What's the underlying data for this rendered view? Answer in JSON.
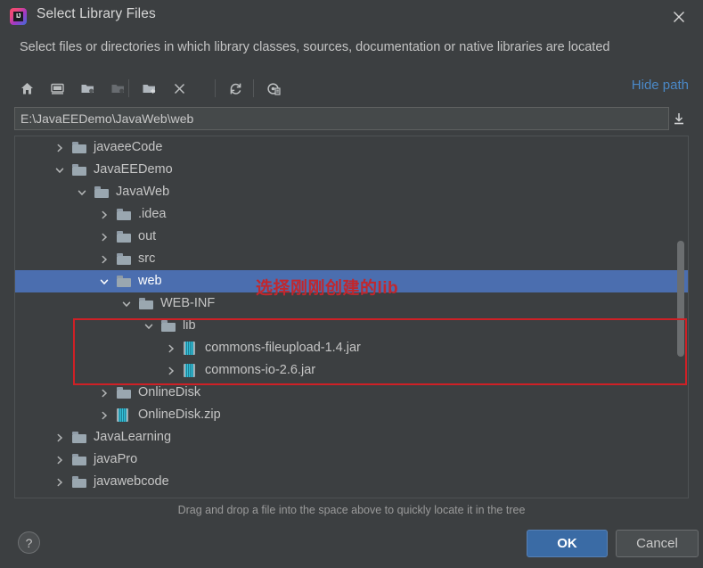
{
  "window": {
    "title": "Select Library Files",
    "app_icon": "intellij-idea-icon",
    "app_icon_text": "IJ",
    "close_icon": "close-icon",
    "description": "Select files or directories in which library classes, sources, documentation or native libraries are located"
  },
  "toolbar": {
    "buttons": [
      {
        "name": "home-icon",
        "tooltip": "Home",
        "disabled": false
      },
      {
        "name": "desktop-icon",
        "tooltip": "Desktop",
        "disabled": false
      },
      {
        "name": "project-folder-icon",
        "tooltip": "Project Directory",
        "disabled": false
      },
      {
        "name": "module-folder-icon",
        "tooltip": "Module Directory",
        "disabled": true
      },
      {
        "name": "new-folder-icon",
        "tooltip": "New Folder",
        "disabled": false
      },
      {
        "name": "delete-icon",
        "tooltip": "Delete",
        "disabled": false
      },
      {
        "name": "refresh-icon",
        "tooltip": "Refresh",
        "disabled": false
      },
      {
        "name": "show-hidden-files-icon",
        "tooltip": "Show Hidden Files",
        "disabled": false
      }
    ],
    "hide_path_label": "Hide path"
  },
  "path": {
    "value": "E:\\JavaEEDemo\\JavaWeb\\web",
    "placeholder": "",
    "expand_icon": "expand-path-icon"
  },
  "tree": {
    "rows": [
      {
        "label": "javaeeCode",
        "depth": 1,
        "icon": "folder-icon",
        "arrow": "collapsed",
        "selected": false
      },
      {
        "label": "JavaEEDemo",
        "depth": 1,
        "icon": "folder-icon",
        "arrow": "expanded",
        "selected": false
      },
      {
        "label": "JavaWeb",
        "depth": 2,
        "icon": "folder-icon",
        "arrow": "expanded",
        "selected": false
      },
      {
        "label": ".idea",
        "depth": 3,
        "icon": "folder-icon",
        "arrow": "collapsed",
        "selected": false
      },
      {
        "label": "out",
        "depth": 3,
        "icon": "folder-icon",
        "arrow": "collapsed",
        "selected": false
      },
      {
        "label": "src",
        "depth": 3,
        "icon": "folder-icon",
        "arrow": "collapsed",
        "selected": false
      },
      {
        "label": "web",
        "depth": 3,
        "icon": "folder-icon",
        "arrow": "expanded",
        "selected": true
      },
      {
        "label": "WEB-INF",
        "depth": 4,
        "icon": "folder-icon",
        "arrow": "expanded",
        "selected": false
      },
      {
        "label": "lib",
        "depth": 5,
        "icon": "folder-icon",
        "arrow": "expanded",
        "selected": false
      },
      {
        "label": "commons-fileupload-1.4.jar",
        "depth": 6,
        "icon": "jar-icon",
        "arrow": "collapsed",
        "selected": false
      },
      {
        "label": "commons-io-2.6.jar",
        "depth": 6,
        "icon": "jar-icon",
        "arrow": "collapsed",
        "selected": false
      },
      {
        "label": "OnlineDisk",
        "depth": 3,
        "icon": "folder-icon",
        "arrow": "collapsed",
        "selected": false
      },
      {
        "label": "OnlineDisk.zip",
        "depth": 3,
        "icon": "jar-icon",
        "arrow": "collapsed",
        "selected": false
      },
      {
        "label": "JavaLearning",
        "depth": 1,
        "icon": "folder-icon",
        "arrow": "collapsed",
        "selected": false
      },
      {
        "label": "javaPro",
        "depth": 1,
        "icon": "folder-icon",
        "arrow": "collapsed",
        "selected": false
      },
      {
        "label": "javawebcode",
        "depth": 1,
        "icon": "folder-icon",
        "arrow": "collapsed",
        "selected": false
      }
    ],
    "scrollbar": "vertical-scrollbar"
  },
  "annotations": {
    "note_text": "选择刚刚创建的lib",
    "note_color": "#c1272d",
    "box_color": "#cf2026"
  },
  "hint": "Drag and drop a file into the space above to quickly locate it in the tree",
  "footer": {
    "help_label": "?",
    "ok_label": "OK",
    "cancel_label": "Cancel"
  },
  "colors": {
    "background": "#3c3f41",
    "selection": "#4b6eaf",
    "link": "#4a88c7",
    "ok_button": "#3a6ba5"
  }
}
